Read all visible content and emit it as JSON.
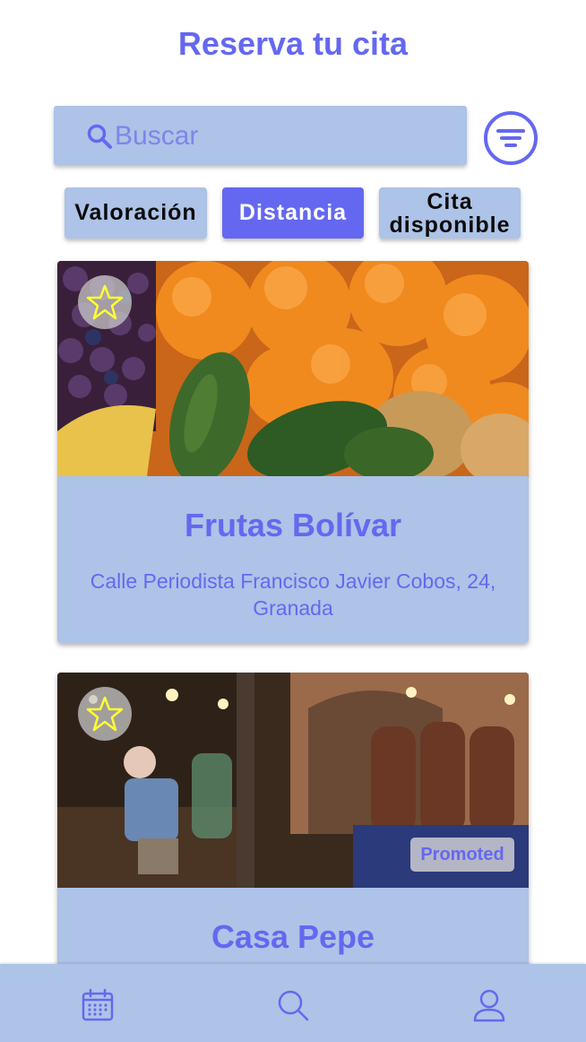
{
  "header": {
    "title": "Reserva tu cita"
  },
  "search": {
    "placeholder": "Buscar",
    "value": ""
  },
  "filters": [
    {
      "label": "Valoración",
      "active": false
    },
    {
      "label": "Distancia",
      "active": true
    },
    {
      "label_line1": "Cita",
      "label_line2": "disponible",
      "active": false
    }
  ],
  "listings": [
    {
      "name": "Frutas Bolívar",
      "address": "Calle Periodista Francisco Javier Cobos, 24, Granada",
      "image": "fruit-produce-photo",
      "promoted": false
    },
    {
      "name": "Casa Pepe",
      "image": "bar-interior-photo",
      "promoted": true,
      "badge": "Promoted"
    }
  ],
  "icons": {
    "search": "search-icon",
    "filter": "filter-icon",
    "favorite": "star-icon",
    "nav": [
      "calendar-icon",
      "search-icon",
      "user-icon"
    ]
  },
  "colors": {
    "accent": "#6468f0",
    "surface": "#adc3e7",
    "star": "#ffff33",
    "text_dark": "#0a0a0a"
  }
}
